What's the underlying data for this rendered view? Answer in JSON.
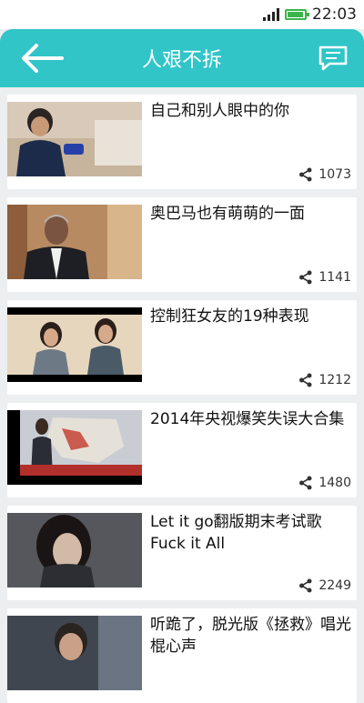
{
  "status": {
    "time": "22:03"
  },
  "appbar": {
    "title": "人艰不拆"
  },
  "videos": [
    {
      "title": "自己和别人眼中的你",
      "shares": "1073"
    },
    {
      "title": "奥巴马也有萌萌的一面",
      "shares": "1141"
    },
    {
      "title": "控制狂女友的19种表现",
      "shares": "1212"
    },
    {
      "title": "2014年央视爆笑失误大合集",
      "shares": "1480"
    },
    {
      "title": "Let it go翻版期末考试歌Fuck it All",
      "shares": "2249"
    },
    {
      "title": "听跪了，脱光版《拯救》唱光棍心声",
      "shares": ""
    }
  ],
  "colors": {
    "accent": "#31c5c8",
    "background": "#eceeef"
  }
}
